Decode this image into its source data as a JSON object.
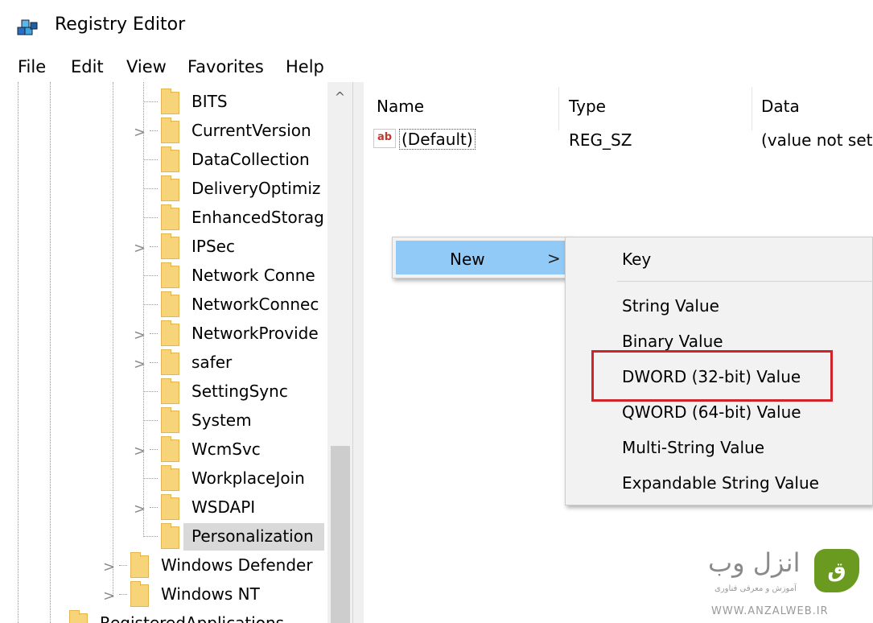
{
  "window": {
    "title": "Registry Editor"
  },
  "menu": [
    "File",
    "Edit",
    "View",
    "Favorites",
    "Help"
  ],
  "tree": {
    "items": [
      "BITS",
      "CurrentVersion",
      "DataCollection",
      "DeliveryOptimiz",
      "EnhancedStorag",
      "IPSec",
      "Network Conne",
      "NetworkConnec",
      "NetworkProvide",
      "safer",
      "SettingSync",
      "System",
      "WcmSvc",
      "WorkplaceJoin",
      "WSDAPI",
      "Personalization"
    ],
    "parent_items": [
      "Windows Defender",
      "Windows NT"
    ],
    "root_item": "RegisteredApplications",
    "selected": "Personalization",
    "expand_glyph": ">",
    "scroll_up_glyph": "^"
  },
  "values": {
    "columns": [
      "Name",
      "Type",
      "Data"
    ],
    "rows": [
      {
        "icon": "ab",
        "name": "(Default)",
        "type": "REG_SZ",
        "data": "(value not set)"
      }
    ]
  },
  "context_menu": {
    "item": "New",
    "arrow": ">"
  },
  "submenu": {
    "items": [
      "Key",
      "String Value",
      "Binary Value",
      "DWORD (32-bit) Value",
      "QWORD (64-bit) Value",
      "Multi-String Value",
      "Expandable String Value"
    ],
    "highlighted": "DWORD (32-bit) Value"
  },
  "watermark": {
    "title": "انزل وب",
    "tagline": "آموزش و معرفی فناوری",
    "url": "WWW.ANZALWEB.IR"
  },
  "colors": {
    "menu_highlight": "#91c9f7",
    "annotation_box": "#d0232a",
    "folder": "#f7d37a",
    "logo": "#6a9a1f"
  },
  "icons": {
    "app": "registry-cubes-icon",
    "value": "string-value-icon",
    "folder": "folder-icon",
    "logo": "anzalweb-logo-icon"
  }
}
